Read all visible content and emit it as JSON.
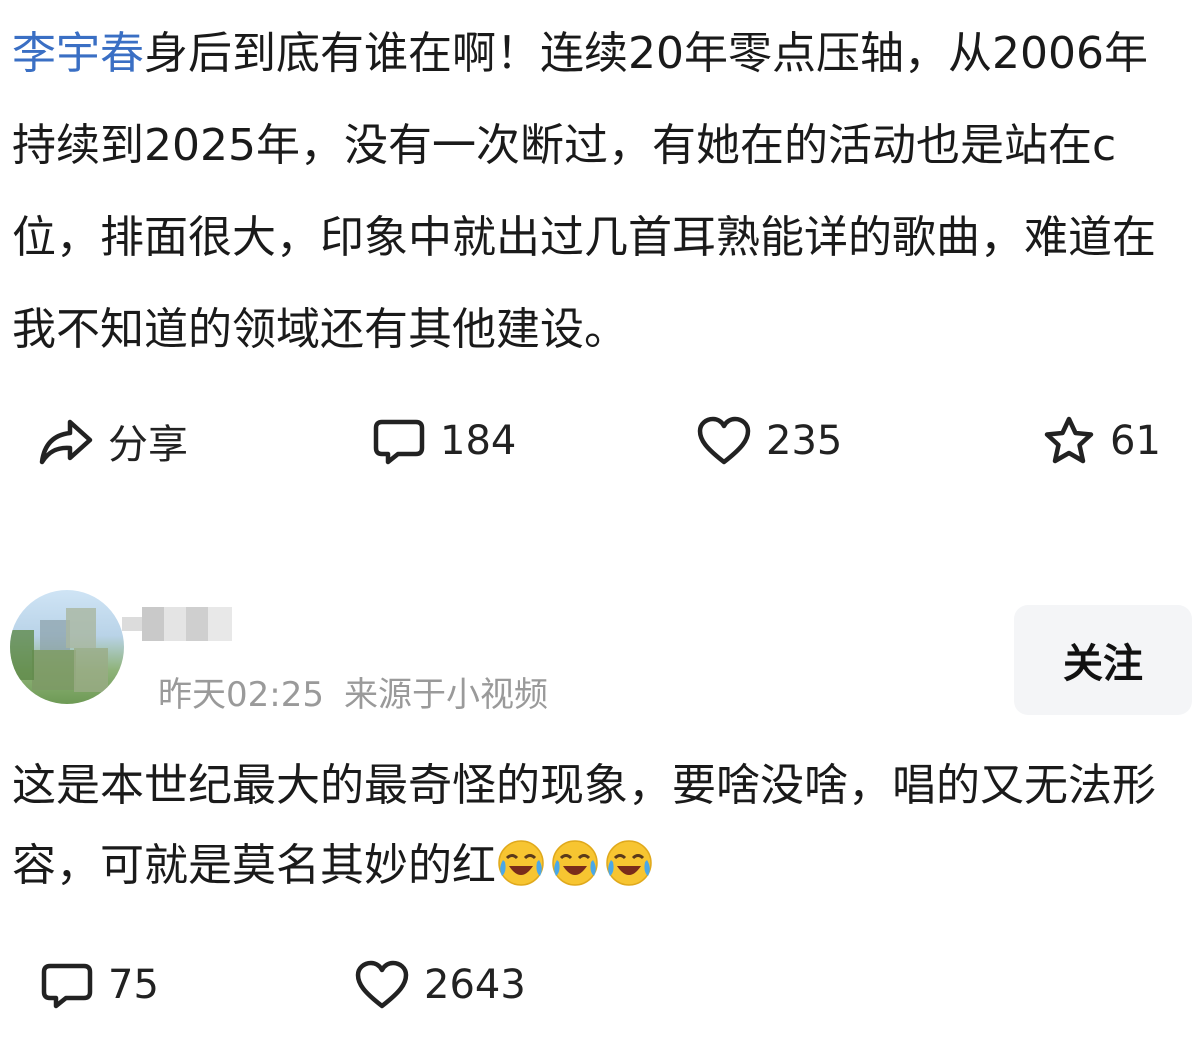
{
  "post": {
    "mention": "李宇春",
    "text": "身后到底有谁在啊！连续20年零点压轴，从2006年持续到2025年，没有一次断过，有她在的活动也是站在c位，排面很大，印象中就出过几首耳熟能详的歌曲，难道在我不知道的领域还有其他建设。",
    "actions": {
      "share_label": "分享",
      "comment_count": "184",
      "like_count": "235",
      "favorite_count": "61"
    }
  },
  "comment": {
    "timestamp": "昨天02:25",
    "source": "来源于小视频",
    "follow_label": "关注",
    "text": "这是本世纪最大的最奇怪的现象，要啥没啥，唱的又无法形容，可就是莫名其妙的红",
    "emojis": [
      "crying-laughing-emoji",
      "crying-laughing-emoji",
      "crying-laughing-emoji"
    ],
    "actions": {
      "comment_count": "75",
      "like_count": "2643"
    }
  },
  "colors": {
    "mention": "#3a6fc4",
    "meta_text": "#9a9a9a",
    "follow_bg": "#f4f5f7",
    "emoji_face": "#f7c531"
  },
  "icons": [
    "share-icon",
    "comment-icon",
    "heart-icon",
    "star-icon"
  ]
}
